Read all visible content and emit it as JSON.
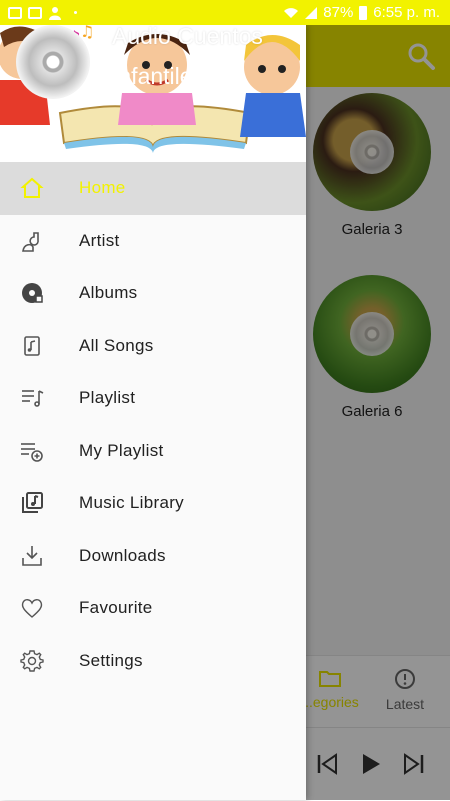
{
  "status_bar": {
    "battery": "87%",
    "time": "6:55 p. m."
  },
  "colors": {
    "accent": "#f2f200",
    "header_yellow": "#e8e400",
    "active_row": "#dcdcdc"
  },
  "app": {
    "galleries": [
      {
        "label": "Galeria 3"
      },
      {
        "label": "Galeria 6"
      }
    ],
    "tabs": [
      {
        "label": "...egories",
        "icon": "folder-icon",
        "active": true
      },
      {
        "label": "Latest",
        "icon": "info-icon",
        "active": false
      }
    ]
  },
  "drawer": {
    "header": {
      "title": "Audio Cuentos",
      "subtitle": "Infantiles"
    },
    "menu": [
      {
        "label": "Home",
        "icon": "home-icon",
        "active": true
      },
      {
        "label": "Artist",
        "icon": "artist-icon",
        "active": false
      },
      {
        "label": "Albums",
        "icon": "album-icon",
        "active": false
      },
      {
        "label": "All Songs",
        "icon": "song-icon",
        "active": false
      },
      {
        "label": "Playlist",
        "icon": "playlist-icon",
        "active": false
      },
      {
        "label": "My Playlist",
        "icon": "playlist-add-icon",
        "active": false
      },
      {
        "label": "Music Library",
        "icon": "music-library-icon",
        "active": false
      },
      {
        "label": "Downloads",
        "icon": "download-icon",
        "active": false
      },
      {
        "label": "Favourite",
        "icon": "heart-icon",
        "active": false
      },
      {
        "label": "Settings",
        "icon": "gear-icon",
        "active": false
      }
    ]
  }
}
